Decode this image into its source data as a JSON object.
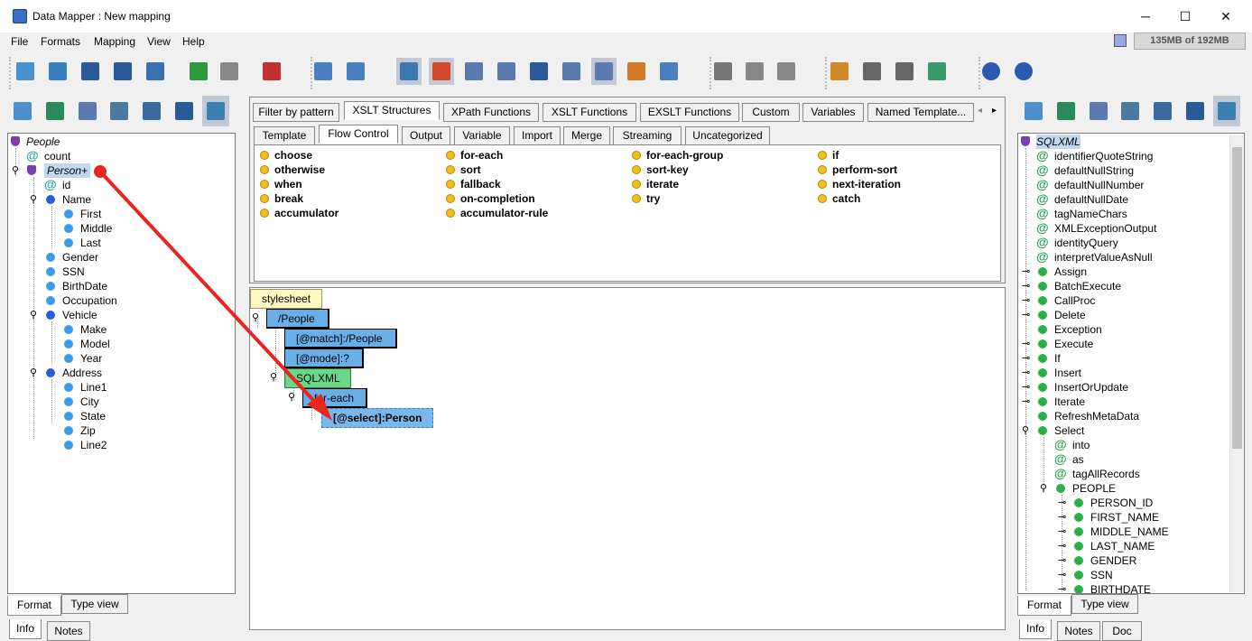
{
  "window": {
    "title": "Data Mapper : New mapping",
    "controls": [
      "─",
      "☐",
      "✕"
    ]
  },
  "menu": [
    "File",
    "Formats",
    "Mapping",
    "View",
    "Help"
  ],
  "memory": "135MB of 192MB",
  "colors": {
    "selection": "#c2c8d6",
    "accent_arrow": "#e8261e",
    "node_blue": "#6aaee8",
    "node_green": "#6ad68a",
    "node_yellow": "#fff8c0"
  },
  "toolbar_icons": [
    "new-mapping-icon",
    "open-icon",
    "save-icon",
    "save-as-icon",
    "export-xls-icon",
    "undo-icon",
    "redo-icon",
    "exit-icon",
    "add-source-icon",
    "settings-icon",
    "show-info-icon",
    "colors-icon",
    "view-list-icon",
    "view-code-icon",
    "save-map-icon",
    "export-icon",
    "xpath-icon",
    "table-icon",
    "database-icon",
    "cut-icon",
    "copy-icon",
    "paste-icon",
    "arrange-icon",
    "align-icon",
    "distribute-icon",
    "layers-icon",
    "help-icon",
    "info-icon"
  ],
  "left_panel": {
    "root": "People",
    "tree": [
      {
        "label": "count",
        "kind": "attr",
        "depth": 1
      },
      {
        "label": "Person+",
        "kind": "element-shield",
        "depth": 1
      },
      {
        "label": "id",
        "kind": "attr",
        "depth": 2
      },
      {
        "label": "Name",
        "kind": "element",
        "depth": 2
      },
      {
        "label": "First",
        "kind": "leaf",
        "depth": 3
      },
      {
        "label": "Middle",
        "kind": "leaf",
        "depth": 3
      },
      {
        "label": "Last",
        "kind": "leaf",
        "depth": 3
      },
      {
        "label": "Gender",
        "kind": "leaf",
        "depth": 2
      },
      {
        "label": "SSN",
        "kind": "leaf",
        "depth": 2
      },
      {
        "label": "BirthDate",
        "kind": "leaf",
        "depth": 2
      },
      {
        "label": "Occupation",
        "kind": "leaf",
        "depth": 2
      },
      {
        "label": "Vehicle",
        "kind": "element",
        "depth": 2
      },
      {
        "label": "Make",
        "kind": "leaf",
        "depth": 3
      },
      {
        "label": "Model",
        "kind": "leaf",
        "depth": 3
      },
      {
        "label": "Year",
        "kind": "leaf",
        "depth": 3
      },
      {
        "label": "Address",
        "kind": "element",
        "depth": 2
      },
      {
        "label": "Line1",
        "kind": "leaf",
        "depth": 3
      },
      {
        "label": "City",
        "kind": "leaf",
        "depth": 3
      },
      {
        "label": "State",
        "kind": "leaf",
        "depth": 3
      },
      {
        "label": "Zip",
        "kind": "leaf",
        "depth": 3
      },
      {
        "label": "Line2",
        "kind": "leaf",
        "depth": 3
      }
    ],
    "view_tabs": [
      "Format",
      "Type view"
    ],
    "bottom_tabs": [
      "Info",
      "Notes"
    ]
  },
  "center": {
    "tabs": [
      "Filter by pattern",
      "XSLT Structures",
      "XPath Functions",
      "XSLT Functions",
      "EXSLT Functions",
      "Custom",
      "Variables",
      "Named Template..."
    ],
    "subtabs": [
      "Template",
      "Flow Control",
      "Output",
      "Variable",
      "Import",
      "Merge",
      "Streaming",
      "Uncategorized"
    ],
    "flow_control": [
      [
        "choose",
        "for-each",
        "for-each-group",
        "if"
      ],
      [
        "otherwise",
        "sort",
        "sort-key",
        "perform-sort"
      ],
      [
        "when",
        "fallback",
        "iterate",
        "next-iteration"
      ],
      [
        "break",
        "on-completion",
        "try",
        "catch"
      ],
      [
        "accumulator",
        "accumulator-rule"
      ]
    ],
    "mapping_nodes": {
      "stylesheet": "stylesheet",
      "people": "/People",
      "match": "[@match]:/People",
      "mode": "[@mode]:?",
      "sqlxml": "SQLXML",
      "foreach": "for-each",
      "select": "[@select]:Person"
    }
  },
  "right_panel": {
    "root": "SQLXML",
    "tree": [
      {
        "label": "identifierQuoteString",
        "kind": "attr"
      },
      {
        "label": "defaultNullString",
        "kind": "attr"
      },
      {
        "label": "defaultNullNumber",
        "kind": "attr"
      },
      {
        "label": "defaultNullDate",
        "kind": "attr"
      },
      {
        "label": "tagNameChars",
        "kind": "attr"
      },
      {
        "label": "XMLExceptionOutput",
        "kind": "attr"
      },
      {
        "label": "identityQuery",
        "kind": "attr"
      },
      {
        "label": "interpretValueAsNull",
        "kind": "attr"
      },
      {
        "label": "Assign",
        "kind": "collapsed"
      },
      {
        "label": "BatchExecute",
        "kind": "collapsed"
      },
      {
        "label": "CallProc",
        "kind": "collapsed"
      },
      {
        "label": "Delete",
        "kind": "collapsed"
      },
      {
        "label": "Exception",
        "kind": "leaf"
      },
      {
        "label": "Execute",
        "kind": "collapsed"
      },
      {
        "label": "If",
        "kind": "collapsed"
      },
      {
        "label": "Insert",
        "kind": "collapsed"
      },
      {
        "label": "InsertOrUpdate",
        "kind": "collapsed"
      },
      {
        "label": "Iterate",
        "kind": "collapsed"
      },
      {
        "label": "RefreshMetaData",
        "kind": "leaf"
      },
      {
        "label": "Select",
        "kind": "expanded"
      },
      {
        "label": "into",
        "kind": "attr2"
      },
      {
        "label": "as",
        "kind": "attr2"
      },
      {
        "label": "tagAllRecords",
        "kind": "attr2"
      },
      {
        "label": "PEOPLE",
        "kind": "expanded2"
      },
      {
        "label": "PERSON_ID",
        "kind": "collapsed3"
      },
      {
        "label": "FIRST_NAME",
        "kind": "collapsed3"
      },
      {
        "label": "MIDDLE_NAME",
        "kind": "collapsed3"
      },
      {
        "label": "LAST_NAME",
        "kind": "collapsed3"
      },
      {
        "label": "GENDER",
        "kind": "collapsed3"
      },
      {
        "label": "SSN",
        "kind": "collapsed3"
      },
      {
        "label": "BIRTHDATE",
        "kind": "collapsed3"
      }
    ],
    "view_tabs": [
      "Format",
      "Type view"
    ],
    "bottom_tabs": [
      "Info",
      "Notes",
      "Doc"
    ]
  }
}
